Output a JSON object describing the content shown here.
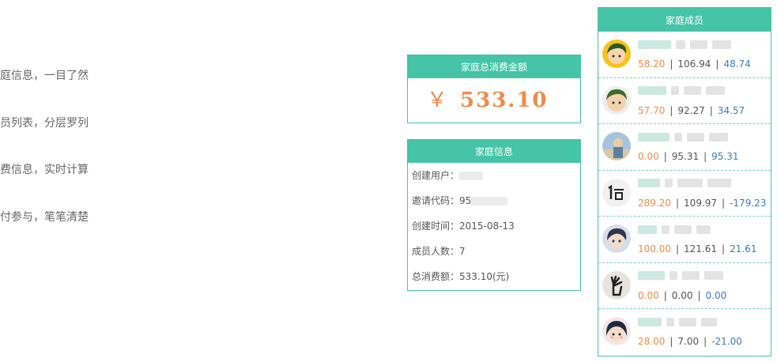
{
  "features": [
    "家庭信息，一目了然",
    "成员列表，分层罗列",
    "消费信息，实时计算",
    "支付参与，笔笔清楚"
  ],
  "total_panel": {
    "title": "家庭总消费金额",
    "currency": "￥",
    "amount": "533.10"
  },
  "info_panel": {
    "title": "家庭信息",
    "rows": [
      {
        "label": "创建用户：",
        "value": ""
      },
      {
        "label": "邀请代码：",
        "value": "95"
      },
      {
        "label": "创建时间：",
        "value": "2015-08-13"
      },
      {
        "label": "成员人数：",
        "value": "7"
      },
      {
        "label": "总消费额：",
        "value": "533.10(元)"
      }
    ]
  },
  "members_panel": {
    "title": "家庭成员",
    "members": [
      {
        "a": "58.20",
        "b": "106.94",
        "c": "48.74",
        "avatar": "yellow-avatar-icon"
      },
      {
        "a": "57.70",
        "b": "92.27",
        "c": "34.57",
        "avatar": "green-avatar-icon"
      },
      {
        "a": "0.00",
        "b": "95.31",
        "c": "95.31",
        "avatar": "photo-avatar-icon"
      },
      {
        "a": "289.20",
        "b": "109.97",
        "c": "-179.23",
        "avatar": "text-avatar-icon"
      },
      {
        "a": "100.00",
        "b": "121.61",
        "c": "21.61",
        "avatar": "anime-avatar-icon"
      },
      {
        "a": "0.00",
        "b": "0.00",
        "c": "0.00",
        "avatar": "hand-avatar-icon"
      },
      {
        "a": "28.00",
        "b": "7.00",
        "c": "-21.00",
        "avatar": "girl-avatar-icon"
      }
    ]
  },
  "colors": {
    "accent": "#45c4a7",
    "orange": "#f08b46",
    "blue": "#3a7dbd"
  }
}
